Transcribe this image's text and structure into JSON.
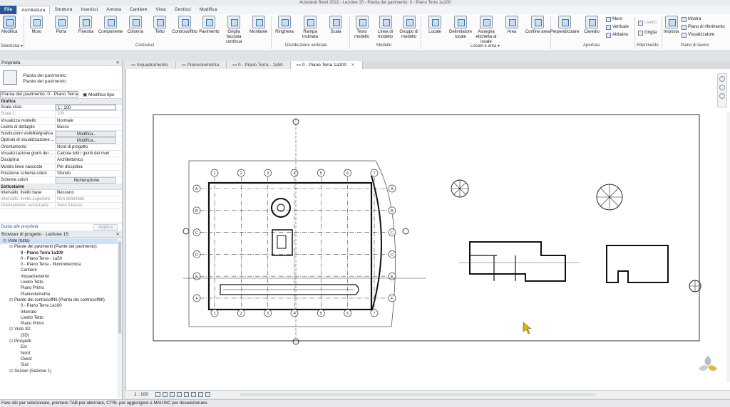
{
  "titlebar": {
    "text": "Autodesk Revit 2022 - Lezione 15 - Pianta del pavimento: 0 - Piano Terra 1a100"
  },
  "tabs": [
    {
      "label": "File",
      "kind": "file"
    },
    {
      "label": "Architettura",
      "kind": "active"
    },
    {
      "label": "Struttura",
      "kind": ""
    },
    {
      "label": "Inserisci",
      "kind": ""
    },
    {
      "label": "Annota",
      "kind": ""
    },
    {
      "label": "Cantiere",
      "kind": ""
    },
    {
      "label": "Vista",
      "kind": ""
    },
    {
      "label": "Gestisci",
      "kind": ""
    },
    {
      "label": "Modifica",
      "kind": ""
    }
  ],
  "ribbon": {
    "modify": "Modifica",
    "select": "Seleziona ▾",
    "build_buttons": [
      "Muro",
      "Porta",
      "Finestra",
      "Componente",
      "Colonna",
      "Tetto",
      "Controsoffitto",
      "Pavimento",
      "Griglia facciata continua",
      "Montante"
    ],
    "circ_buttons": [
      "Ringhiera",
      "Rampa inclinata",
      "Scala"
    ],
    "model_buttons": [
      "Testo modello",
      "Linea di modello",
      "Gruppo di modello"
    ],
    "room_buttons": [
      "Locale",
      "Delimitatore locale",
      "Assegna etichetta al locale",
      "Area",
      "Confine area"
    ],
    "opening_buttons": [
      "Perpendicolare",
      "Cavedio"
    ],
    "opening_small": [
      "Muro",
      "Verticale",
      "Abbaino"
    ],
    "datum_small": [
      "Livello",
      "Griglia"
    ],
    "workplane_button": "Imposta",
    "workplane_small": [
      "Mostra",
      "Piano di riferimento",
      "Visualizzatore"
    ],
    "groups": [
      "Costruisci",
      "Distribuzione verticale",
      "Modello",
      "Locale e area ▾",
      "Apertura",
      "Riferimento",
      "Piano di lavoro"
    ]
  },
  "properties": {
    "title": "Proprietà",
    "type_line1": "Pianta del pavimento",
    "type_line2": "Piante del pavimento",
    "instance": "Pianta del pavimento: 0 - Piano Terra 1",
    "edit_type": "Modifica tipo",
    "group_graphics": "Grafica",
    "rows": [
      {
        "k": "Scala vista",
        "v": "1 : 100",
        "style": "box"
      },
      {
        "k": "Scala 1:",
        "v": "100",
        "style": "gray"
      },
      {
        "k": "Visualizza modello",
        "v": "Normale",
        "style": ""
      },
      {
        "k": "Livello di dettaglio",
        "v": "Basso",
        "style": ""
      },
      {
        "k": "Sostituzioni visibilità/grafica",
        "v": "Modifica...",
        "style": "btn"
      },
      {
        "k": "Opzioni di visualizzazione ...",
        "v": "Modifica...",
        "style": "btn"
      },
      {
        "k": "Orientamento",
        "v": "Nord di progetto",
        "style": ""
      },
      {
        "k": "Visualizzazione giunti dei ...",
        "v": "Calcola tutti i giunti dei muri",
        "style": ""
      },
      {
        "k": "Disciplina",
        "v": "Architettonico",
        "style": ""
      },
      {
        "k": "Mostra linee nascoste",
        "v": "Per disciplina",
        "style": ""
      },
      {
        "k": "Posizione schema colori",
        "v": "Sfondo",
        "style": ""
      },
      {
        "k": "Schema colori",
        "v": "Numerazione",
        "style": "btn"
      }
    ],
    "group_underlay": "Sottostante",
    "rows2": [
      {
        "k": "Intervallo: livello base",
        "v": "Nessuno",
        "style": ""
      },
      {
        "k": "Intervallo: livello superiore",
        "v": "Non delimitato",
        "style": "gray"
      },
      {
        "k": "Orientamento sottostante",
        "v": "Vano il basso",
        "style": "gray"
      }
    ],
    "help_link": "Guida alle proprietà",
    "apply": "Applica"
  },
  "browser": {
    "title": "Browser di progetto - Lezione 15",
    "items": [
      {
        "label": "Viste (tutto)",
        "level": 0,
        "exp": "⊟",
        "sel": true,
        "bold": false
      },
      {
        "label": "Piante dei pavimenti (Piante del pavimento)",
        "level": 1,
        "exp": "⊟",
        "sel": false,
        "bold": false
      },
      {
        "label": "0 - Piano Terra 1a100",
        "level": 2,
        "exp": "",
        "sel": false,
        "bold": true
      },
      {
        "label": "0 - Piano Terra - 1a50",
        "level": 2,
        "exp": "",
        "sel": false,
        "bold": false
      },
      {
        "label": "0 - Piano Terra - Illuminotecnica",
        "level": 2,
        "exp": "",
        "sel": false,
        "bold": false
      },
      {
        "label": "Cantiere",
        "level": 2,
        "exp": "",
        "sel": false,
        "bold": false
      },
      {
        "label": "Inquadramento",
        "level": 2,
        "exp": "",
        "sel": false,
        "bold": false
      },
      {
        "label": "Livello Tetto",
        "level": 2,
        "exp": "",
        "sel": false,
        "bold": false
      },
      {
        "label": "Piano Primo",
        "level": 2,
        "exp": "",
        "sel": false,
        "bold": false
      },
      {
        "label": "Planivolumetria",
        "level": 2,
        "exp": "",
        "sel": false,
        "bold": false
      },
      {
        "label": "Piante dei controsoffitti (Pianta dei controsoffitti)",
        "level": 1,
        "exp": "⊟",
        "sel": false,
        "bold": false
      },
      {
        "label": "0 - Piano Terra 1a100",
        "level": 2,
        "exp": "",
        "sel": false,
        "bold": false
      },
      {
        "label": "Interrato",
        "level": 2,
        "exp": "",
        "sel": false,
        "bold": false
      },
      {
        "label": "Livello Tetto",
        "level": 2,
        "exp": "",
        "sel": false,
        "bold": false
      },
      {
        "label": "Piano Primo",
        "level": 2,
        "exp": "",
        "sel": false,
        "bold": false
      },
      {
        "label": "Viste 3D",
        "level": 1,
        "exp": "⊟",
        "sel": false,
        "bold": false
      },
      {
        "label": "{3D}",
        "level": 2,
        "exp": "",
        "sel": false,
        "bold": false
      },
      {
        "label": "Prospetti",
        "level": 1,
        "exp": "⊟",
        "sel": false,
        "bold": false
      },
      {
        "label": "Est",
        "level": 2,
        "exp": "",
        "sel": false,
        "bold": false
      },
      {
        "label": "Nord",
        "level": 2,
        "exp": "",
        "sel": false,
        "bold": false
      },
      {
        "label": "Ovest",
        "level": 2,
        "exp": "",
        "sel": false,
        "bold": false
      },
      {
        "label": "Sud",
        "level": 2,
        "exp": "",
        "sel": false,
        "bold": false
      },
      {
        "label": "Sezioni (Sezione 1)",
        "level": 1,
        "exp": "⊟",
        "sel": false,
        "bold": false
      }
    ]
  },
  "viewtabs": [
    {
      "label": "Inquadramento",
      "active": false
    },
    {
      "label": "Planivolumetria",
      "active": false
    },
    {
      "label": "0 - Piano Terra - 1a50",
      "active": false
    },
    {
      "label": "0 - Piano Terra 1a100",
      "active": true
    }
  ],
  "drawing": {
    "grid_cols": [
      "1",
      "2",
      "3",
      "4",
      "5",
      "6",
      "7"
    ],
    "grid_rows": [
      "A",
      "B",
      "C",
      "D",
      "E",
      "F"
    ]
  },
  "viewbar": {
    "scale": "1 : 100"
  },
  "status": {
    "text": "Fare clic per selezionare, premere TAB per alternare, CTRL per aggiungere e MAIUSC per deselezionare."
  }
}
